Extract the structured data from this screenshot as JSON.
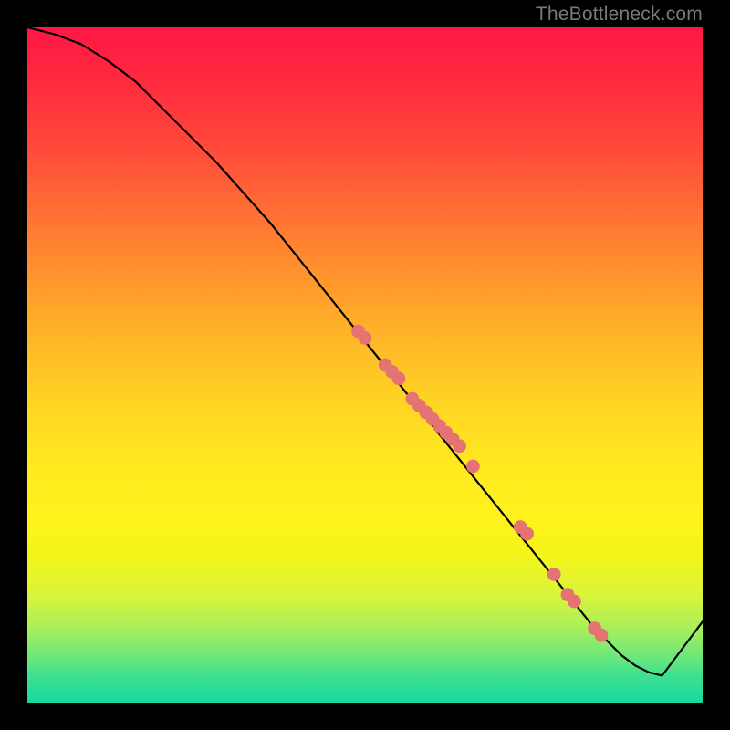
{
  "watermark": "TheBottleneck.com",
  "chart_data": {
    "type": "line",
    "title": "",
    "xlabel": "",
    "ylabel": "",
    "xlim": [
      0,
      100
    ],
    "ylim": [
      0,
      100
    ],
    "grid": false,
    "legend": false,
    "series": [
      {
        "name": "curve",
        "color": "#000000",
        "x": [
          0,
          4,
          8,
          12,
          16,
          20,
          24,
          28,
          32,
          36,
          40,
          44,
          48,
          52,
          56,
          60,
          64,
          68,
          72,
          74,
          76,
          78,
          80,
          82,
          84,
          86,
          88,
          90,
          92,
          94,
          100
        ],
        "y": [
          100,
          99,
          97.5,
          95,
          92,
          88,
          84,
          80,
          75.5,
          71,
          66,
          61,
          56,
          51,
          46,
          41,
          36,
          31,
          26,
          23.5,
          21,
          18.5,
          16,
          13.5,
          11,
          9,
          7,
          5.5,
          4.5,
          4,
          12
        ]
      },
      {
        "name": "markers",
        "color": "#e57373",
        "type": "scatter",
        "x": [
          49,
          50,
          53,
          54,
          55,
          57,
          58,
          59,
          60,
          61,
          62,
          63,
          64,
          66,
          73,
          74,
          78,
          80,
          81,
          84,
          85
        ],
        "y": [
          55,
          54,
          50,
          49,
          48,
          45,
          44,
          43,
          42,
          41,
          40,
          39,
          38,
          35,
          26,
          25,
          19,
          16,
          15,
          11,
          10
        ]
      }
    ]
  }
}
